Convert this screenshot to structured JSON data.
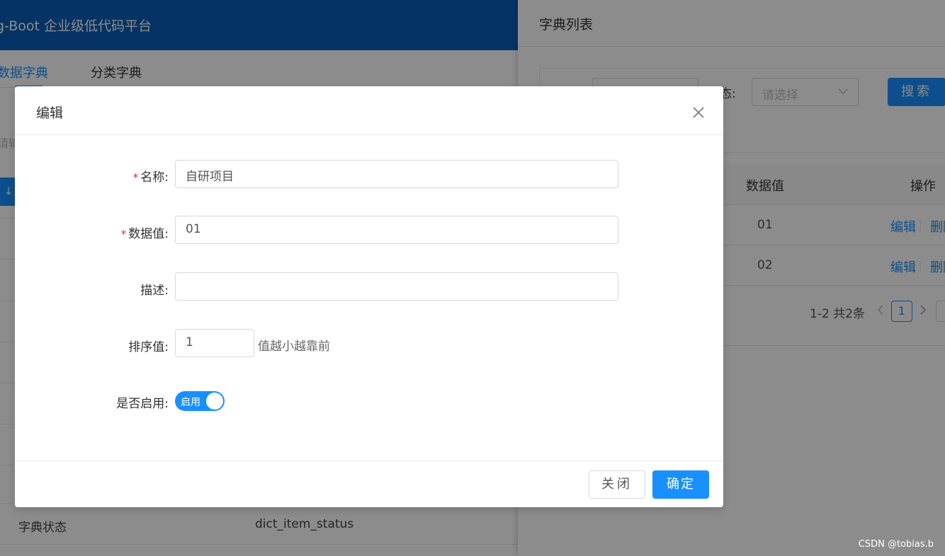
{
  "app": {
    "title": "g-Boot 企业级低代码平台"
  },
  "tabs": [
    {
      "label": "数据字典",
      "active": true
    },
    {
      "label": "分类字典",
      "active": false
    }
  ],
  "background": {
    "search_placeholder_fragment": "请输",
    "button_fragment": "↓",
    "row_label": "字典状态",
    "row_code": "dict_item_status"
  },
  "drawer": {
    "title": "字典列表",
    "status_label": "态:",
    "status_placeholder": "请选择",
    "search_button": "搜索",
    "columns": {
      "value": "数据值",
      "actions": "操作"
    },
    "rows": [
      {
        "value": "01",
        "edit": "编辑",
        "delete": "删除"
      },
      {
        "value": "02",
        "edit": "编辑",
        "delete": "删除"
      }
    ],
    "pagination": {
      "total": "1-2 共2条",
      "current": "1"
    }
  },
  "modal": {
    "title": "编辑",
    "fields": {
      "name": {
        "label": "名称:",
        "value": "自研项目",
        "required": true
      },
      "value": {
        "label": "数据值:",
        "value": "01",
        "required": true
      },
      "description": {
        "label": "描述:",
        "value": ""
      },
      "sort": {
        "label": "排序值:",
        "value": "1",
        "hint": "值越小越靠前"
      },
      "enabled": {
        "label": "是否启用:",
        "switch_text": "启用",
        "checked": true
      }
    },
    "cancel": "关闭",
    "ok": "确定"
  },
  "watermark": "CSDN @tobias.b",
  "colors": {
    "primary": "#1890ff",
    "header": "#0a5db8",
    "required": "#f5222d"
  }
}
